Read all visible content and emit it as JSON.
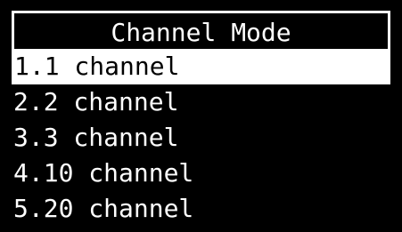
{
  "title": "Channel Mode",
  "colors": {
    "background": "#000000",
    "foreground": "#ffffff",
    "selected_background": "#ffffff",
    "selected_foreground": "#000000"
  },
  "menu": {
    "selected_index": 0,
    "items": [
      {
        "label": "1.1 channel"
      },
      {
        "label": "2.2 channel"
      },
      {
        "label": "3.3 channel"
      },
      {
        "label": "4.10 channel"
      },
      {
        "label": "5.20 channel"
      }
    ]
  }
}
